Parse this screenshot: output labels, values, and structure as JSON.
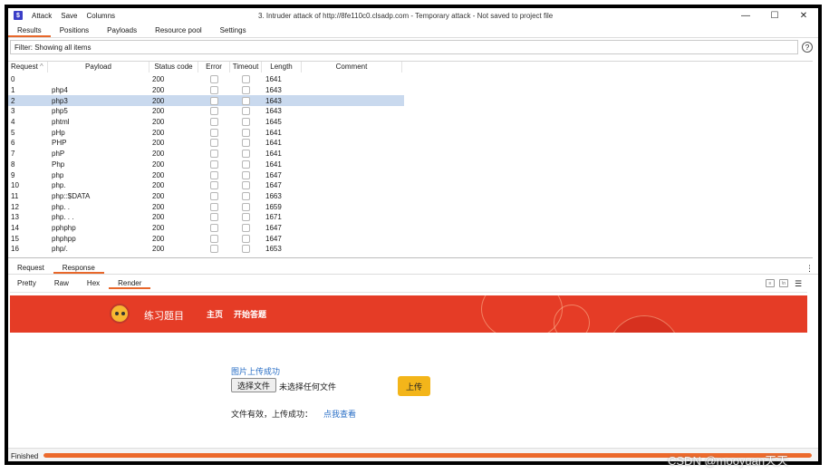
{
  "app": {
    "logo": "$",
    "menu": [
      "Attack",
      "Save",
      "Columns"
    ],
    "title": "3. Intruder attack of http://8fe110c0.clsadp.com - Temporary attack - Not saved to project file",
    "controls": [
      "—",
      "☐",
      "✕"
    ]
  },
  "tabs": [
    "Results",
    "Positions",
    "Payloads",
    "Resource pool",
    "Settings"
  ],
  "filter": {
    "text": "Filter: Showing all items",
    "help": "?"
  },
  "table": {
    "headers": [
      "Request",
      "Payload",
      "Status code",
      "Error",
      "Timeout",
      "Length",
      "Comment"
    ],
    "sort_indicator": "^",
    "selected_row": 2,
    "rows": [
      {
        "request": "0",
        "payload": "",
        "status": "200",
        "length": "1641"
      },
      {
        "request": "1",
        "payload": "php4",
        "status": "200",
        "length": "1643"
      },
      {
        "request": "2",
        "payload": "php3",
        "status": "200",
        "length": "1643"
      },
      {
        "request": "3",
        "payload": "php5",
        "status": "200",
        "length": "1643"
      },
      {
        "request": "4",
        "payload": "phtml",
        "status": "200",
        "length": "1645"
      },
      {
        "request": "5",
        "payload": "pHp",
        "status": "200",
        "length": "1641"
      },
      {
        "request": "6",
        "payload": "PHP",
        "status": "200",
        "length": "1641"
      },
      {
        "request": "7",
        "payload": "phP",
        "status": "200",
        "length": "1641"
      },
      {
        "request": "8",
        "payload": "Php",
        "status": "200",
        "length": "1641"
      },
      {
        "request": "9",
        "payload": "php",
        "status": "200",
        "length": "1647"
      },
      {
        "request": "10",
        "payload": "php.",
        "status": "200",
        "length": "1647"
      },
      {
        "request": "11",
        "payload": "php::$DATA",
        "status": "200",
        "length": "1663"
      },
      {
        "request": "12",
        "payload": "php. .",
        "status": "200",
        "length": "1659"
      },
      {
        "request": "13",
        "payload": "php. . .",
        "status": "200",
        "length": "1671"
      },
      {
        "request": "14",
        "payload": "pphphp",
        "status": "200",
        "length": "1647"
      },
      {
        "request": "15",
        "payload": "phphpp",
        "status": "200",
        "length": "1647"
      },
      {
        "request": "16",
        "payload": "php/.",
        "status": "200",
        "length": "1653"
      }
    ]
  },
  "lower_tabs": [
    "Request",
    "Response"
  ],
  "view_tabs": [
    "Pretty",
    "Raw",
    "Hex",
    "Render"
  ],
  "render": {
    "brand": "练习题目",
    "nav": [
      "主页",
      "开始答题"
    ],
    "upload_msg": "图片上传成功",
    "file_button": "选择文件",
    "file_none": "未选择任何文件",
    "upload_button": "上传",
    "result_text": "文件有效，上传成功：",
    "result_link": "点我查看"
  },
  "status": {
    "text": "Finished",
    "progress": 1.0
  },
  "watermark": "CSDN @mooyuan天天",
  "colors": {
    "accent": "#e8672a",
    "banner": "#e53c26",
    "selected_row": "#c9d9ee",
    "upload_button": "#f3b51a",
    "link": "#2a6fc6"
  }
}
